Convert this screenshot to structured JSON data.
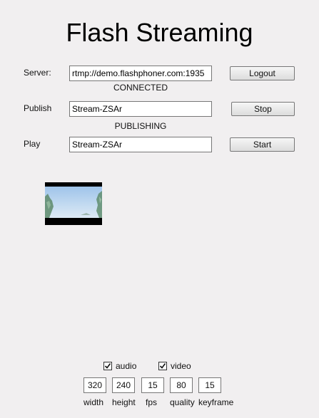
{
  "title": "Flash Streaming",
  "server": {
    "label": "Server:",
    "value": "rtmp://demo.flashphoner.com:1935",
    "button": "Logout",
    "status": "CONNECTED"
  },
  "publish": {
    "label": "Publish",
    "value": "Stream-ZSAr",
    "button": "Stop",
    "status": "PUBLISHING"
  },
  "play": {
    "label": "Play",
    "value": "Stream-ZSAr",
    "button": "Start"
  },
  "options": {
    "audio": {
      "label": "audio",
      "checked": true
    },
    "video": {
      "label": "video",
      "checked": true
    }
  },
  "settings": [
    {
      "value": "320",
      "caption": "width"
    },
    {
      "value": "240",
      "caption": "height"
    },
    {
      "value": "15",
      "caption": "fps"
    },
    {
      "value": "80",
      "caption": "quality"
    },
    {
      "value": "15",
      "caption": "keyframe"
    }
  ]
}
